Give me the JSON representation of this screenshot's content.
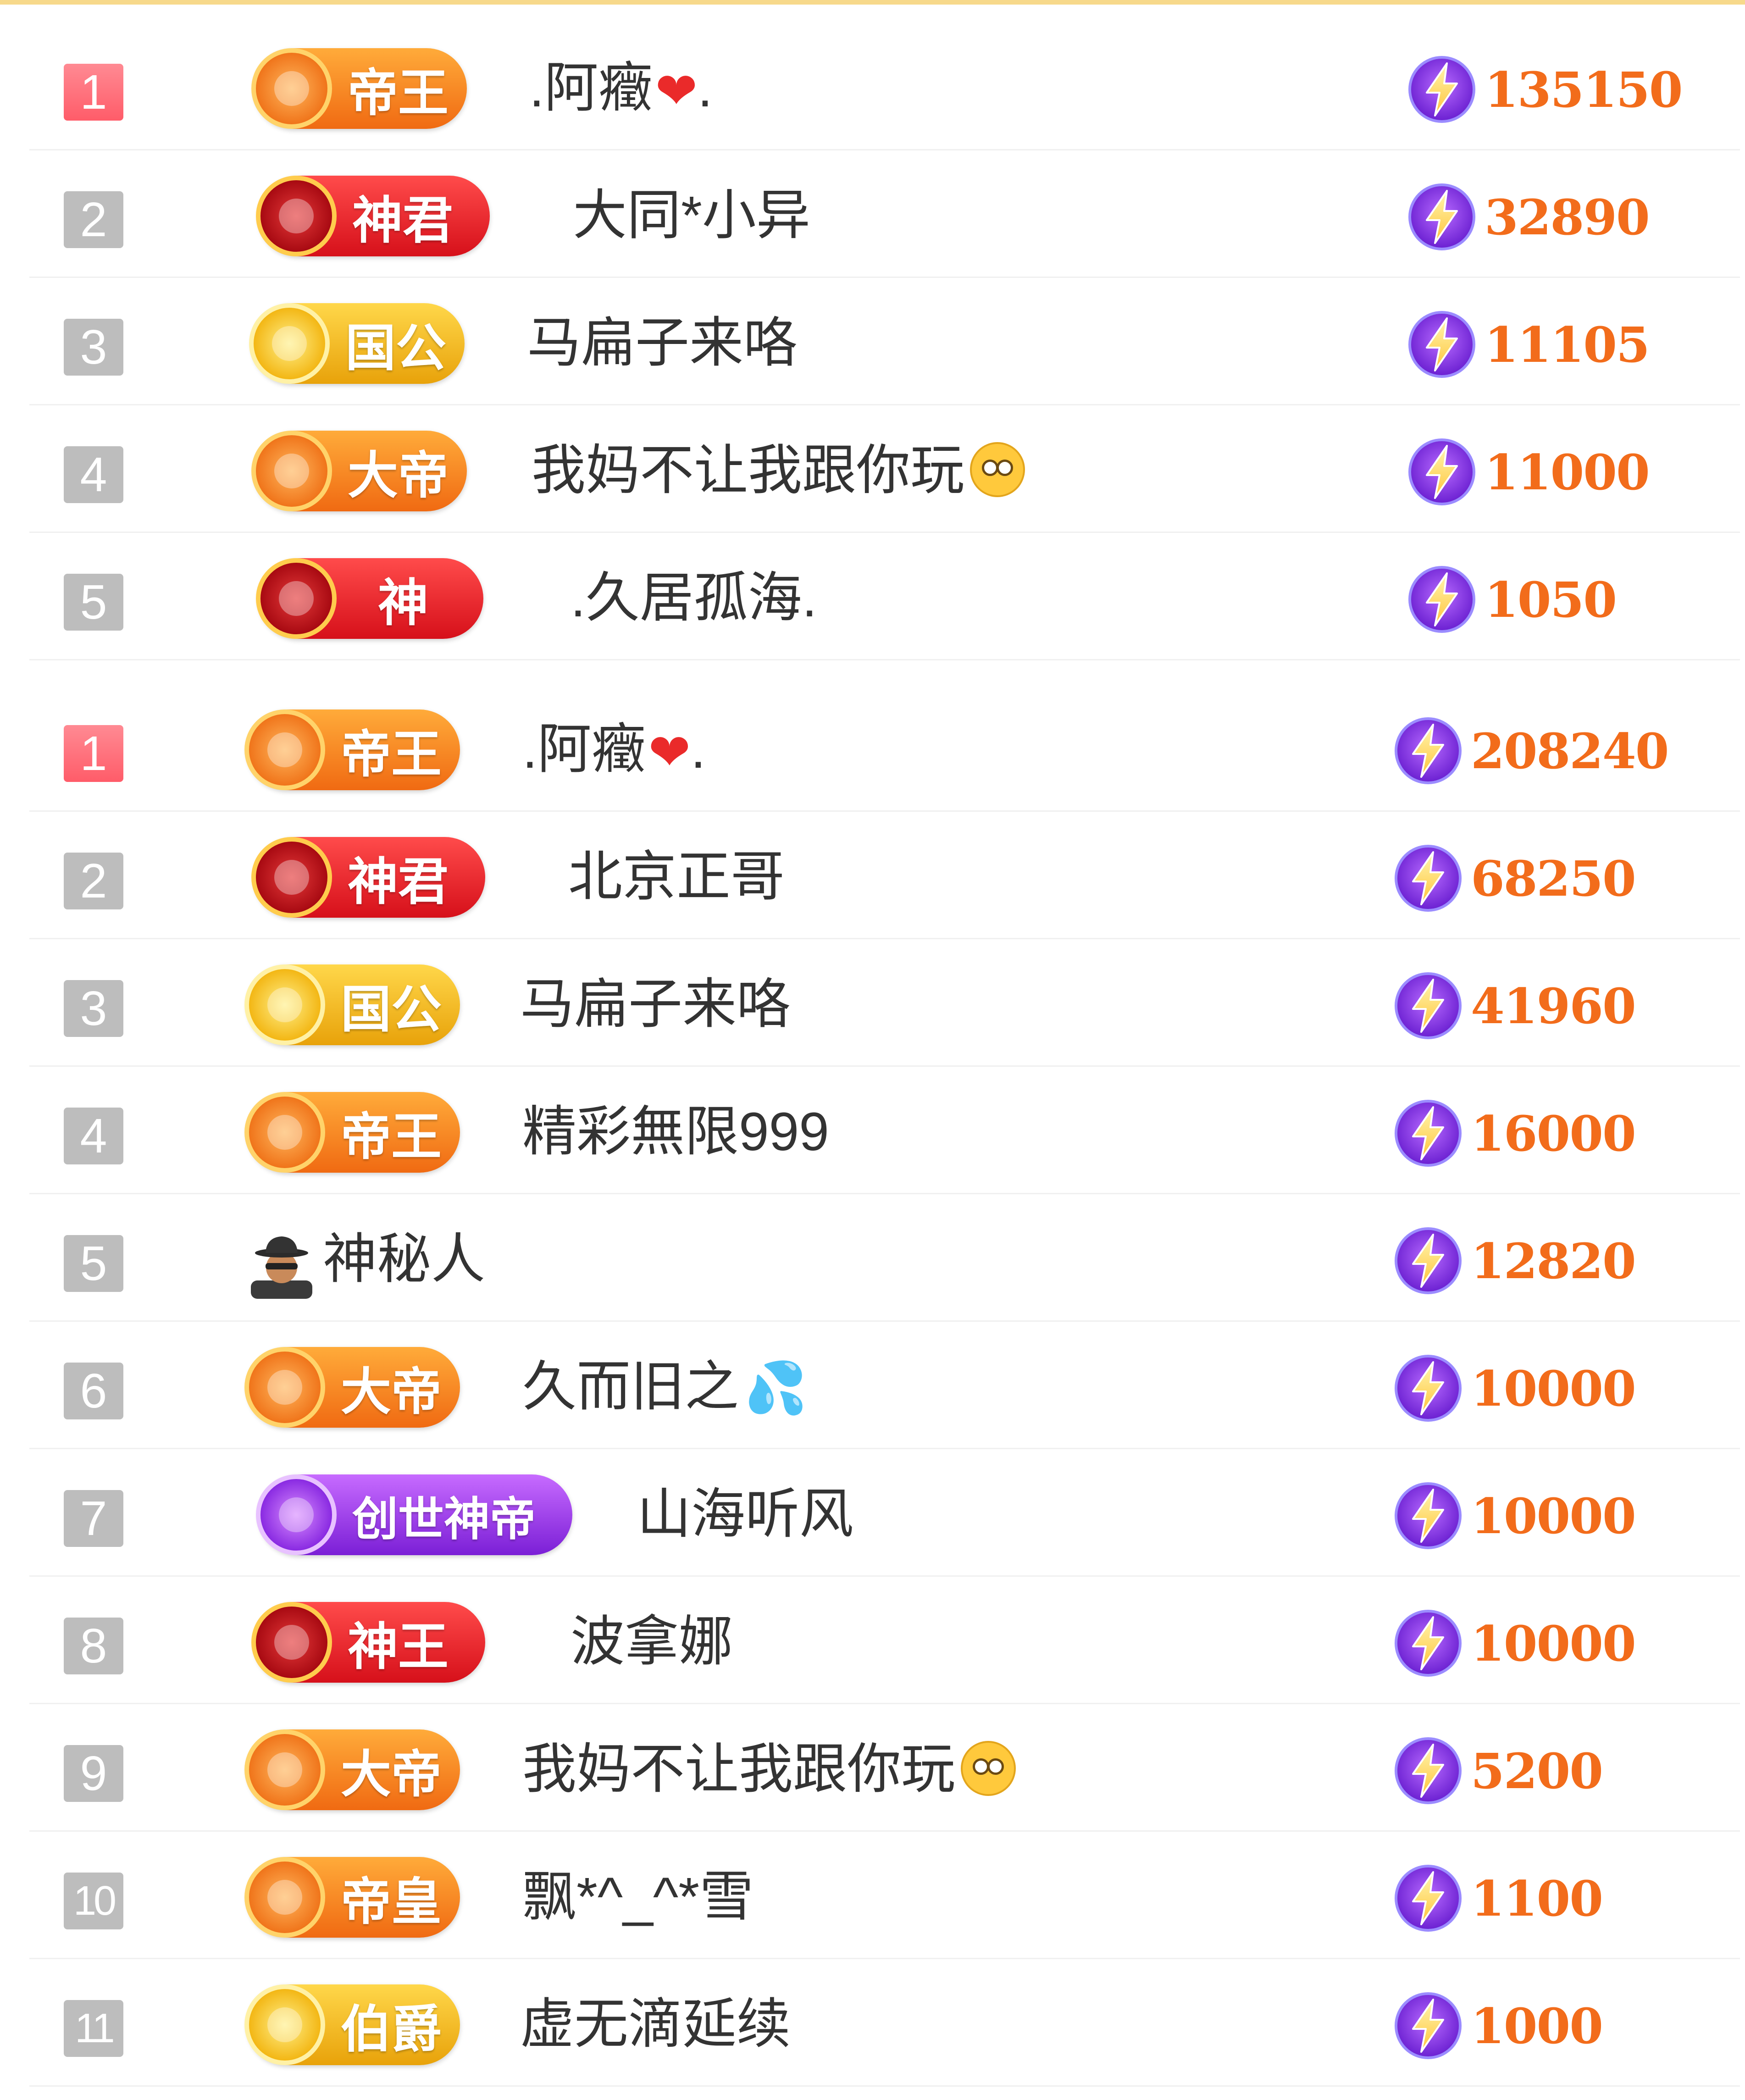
{
  "colors": {
    "top_border": "#f7d98b",
    "rank_first": "#ff5c69",
    "rank_default": "#bdbdbd",
    "score_text": "#f26c1b",
    "name_text": "#333333"
  },
  "icons": {
    "score": "lightning-bolt-icon",
    "mystery": "mystery-person-icon",
    "heart": "heart-icon",
    "emoji": "rolling-eyes-emoji-icon",
    "drops": "sweat-droplets-icon"
  },
  "leaderboard_a": {
    "rows": [
      {
        "rank": "1",
        "badge": "帝王",
        "name": ".阿癥",
        "suffix": "heart",
        "after": ".",
        "score": "135150"
      },
      {
        "rank": "2",
        "badge": "神君",
        "name": "大同*小异",
        "score": "32890"
      },
      {
        "rank": "3",
        "badge": "国公",
        "name": "马扁子来咯",
        "score": "11105"
      },
      {
        "rank": "4",
        "badge": "大帝",
        "name": "我妈不让我跟你玩",
        "suffix": "emoji",
        "score": "11000"
      },
      {
        "rank": "5",
        "badge": "神",
        "name": ".久居孤海.",
        "score": "1050"
      }
    ]
  },
  "leaderboard_b": {
    "rows": [
      {
        "rank": "1",
        "badge": "帝王",
        "name": ".阿癥",
        "after": ".",
        "score": "208240"
      },
      {
        "rank": "2",
        "badge": "神君",
        "name": "北京正哥",
        "score": "68250"
      },
      {
        "rank": "3",
        "badge": "国公",
        "name": "马扁子来咯",
        "score": "41960"
      },
      {
        "rank": "4",
        "badge": "帝王",
        "name": "精彩無限999",
        "score": "16000"
      },
      {
        "rank": "5",
        "name": "神秘人",
        "score": "12820"
      },
      {
        "rank": "6",
        "badge": "大帝",
        "name": "久而旧之",
        "score": "10000"
      },
      {
        "rank": "7",
        "badge": "创世神帝",
        "name": "山海听风",
        "score": "10000"
      },
      {
        "rank": "8",
        "badge": "神王",
        "name": "波拿娜",
        "score": "10000"
      },
      {
        "rank": "9",
        "badge": "大帝",
        "name": "我妈不让我跟你玩",
        "score": "5200"
      },
      {
        "rank": "10",
        "badge": "帝皇",
        "name": "飘*^_^*雪",
        "score": "1100"
      },
      {
        "rank": "11",
        "badge": "伯爵",
        "name": "虚无滴延续",
        "score": "1000"
      }
    ]
  }
}
